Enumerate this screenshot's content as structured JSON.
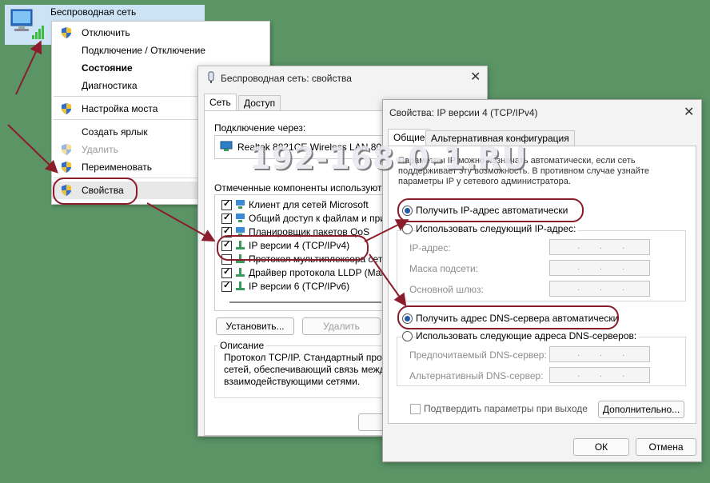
{
  "network": {
    "title": "Беспроводная сеть"
  },
  "context_menu": {
    "items": [
      {
        "label": "Отключить",
        "shield": true,
        "style": "normal"
      },
      {
        "label": "Подключение / Отключение",
        "shield": false,
        "style": "normal"
      },
      {
        "label": "Состояние",
        "shield": false,
        "style": "bold"
      },
      {
        "label": "Диагностика",
        "shield": false,
        "style": "normal"
      },
      {
        "label": "Настройка моста",
        "shield": true,
        "style": "normal"
      },
      {
        "label": "Создать ярлык",
        "shield": false,
        "style": "normal"
      },
      {
        "label": "Удалить",
        "shield": true,
        "style": "disabled"
      },
      {
        "label": "Переименовать",
        "shield": true,
        "style": "normal"
      },
      {
        "label": "Свойства",
        "shield": true,
        "style": "selected"
      }
    ]
  },
  "wireless_props": {
    "title": "Беспроводная сеть: свойства",
    "tabs": [
      "Сеть",
      "Доступ"
    ],
    "connect_via_label": "Подключение через:",
    "adapter": "Realtek 8821CE Wireless LAN 802.11",
    "components_label": "Отмеченные компоненты используются э",
    "components": [
      {
        "label": "Клиент для сетей Microsoft",
        "checked": true
      },
      {
        "label": "Общий доступ к файлам и принте",
        "checked": true
      },
      {
        "label": "Планировщик пакетов QoS",
        "checked": true
      },
      {
        "label": "IP версии 4 (TCP/IPv4)",
        "checked": true
      },
      {
        "label": "Протокол мультиплексора сетев",
        "checked": false
      },
      {
        "label": "Драйвер протокола LLDP (Майк",
        "checked": true
      },
      {
        "label": "IP версии 6 (TCP/IPv6)",
        "checked": true
      }
    ],
    "install_button": "Установить...",
    "remove_button": "Удалить",
    "description_label": "Описание",
    "description_text": [
      "Протокол TCP/IP. Стандартный протог",
      "сетей, обеспечивающий связь между р",
      "взаимодействующими сетями."
    ]
  },
  "ipv4_props": {
    "title": "Свойства: IP версии 4 (TCP/IPv4)",
    "tabs": [
      "Общие",
      "Альтернативная конфигурация"
    ],
    "info_text": [
      "Параметры IP можно назначать автоматически, если сеть",
      "поддерживает эту возможность. В противном случае узнайте",
      "параметры IP у сетевого администратора."
    ],
    "auto_ip": "Получить IP-адрес автоматически",
    "manual_ip": "Использовать следующий IP-адрес:",
    "ip_fields": [
      "IP-адрес:",
      "Маска подсети:",
      "Основной шлюз:"
    ],
    "auto_dns": "Получить адрес DNS-сервера автоматически",
    "manual_dns": "Использовать следующие адреса DNS-серверов:",
    "dns_fields": [
      "Предпочитаемый DNS-сервер:",
      "Альтернативный DNS-сервер:"
    ],
    "validate_label": "Подтвердить параметры при выходе",
    "advanced_button": "Дополнительно...",
    "ok_button": "ОК",
    "cancel_button": "Отмена",
    "ip_mode": "auto",
    "dns_mode": "auto"
  },
  "watermark": "192-168-0-1.RU",
  "colors": {
    "highlight": "#8b1c2c",
    "background": "#5b9566",
    "selection": "#cce3f5"
  }
}
